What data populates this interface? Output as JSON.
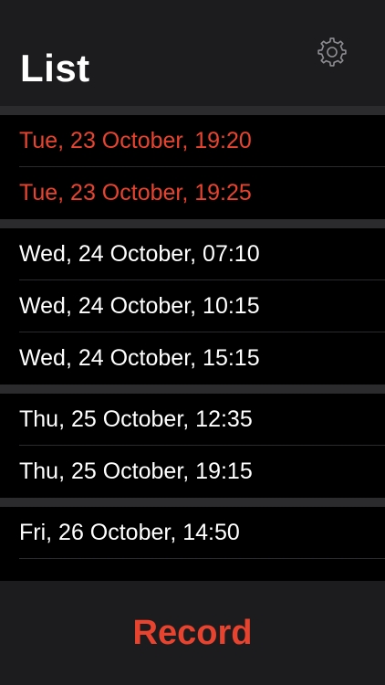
{
  "header": {
    "title": "List",
    "settings_icon": "gear-icon"
  },
  "colors": {
    "accent": "#e8432f",
    "background": "#000000",
    "bar": "#1c1c1e",
    "separator": "#2b2b2d",
    "text": "#ffffff"
  },
  "groups": [
    {
      "items": [
        {
          "label": "Tue, 23 October, 19:20",
          "state": "past"
        },
        {
          "label": "Tue, 23 October, 19:25",
          "state": "past"
        }
      ]
    },
    {
      "items": [
        {
          "label": "Wed, 24 October, 07:10",
          "state": "future"
        },
        {
          "label": "Wed, 24 October, 10:15",
          "state": "future"
        },
        {
          "label": "Wed, 24 October, 15:15",
          "state": "future"
        }
      ]
    },
    {
      "items": [
        {
          "label": "Thu, 25 October, 12:35",
          "state": "future"
        },
        {
          "label": "Thu, 25 October, 19:15",
          "state": "future"
        }
      ]
    },
    {
      "items": [
        {
          "label": "Fri, 26 October, 14:50",
          "state": "future"
        }
      ]
    }
  ],
  "footer": {
    "record_label": "Record"
  }
}
